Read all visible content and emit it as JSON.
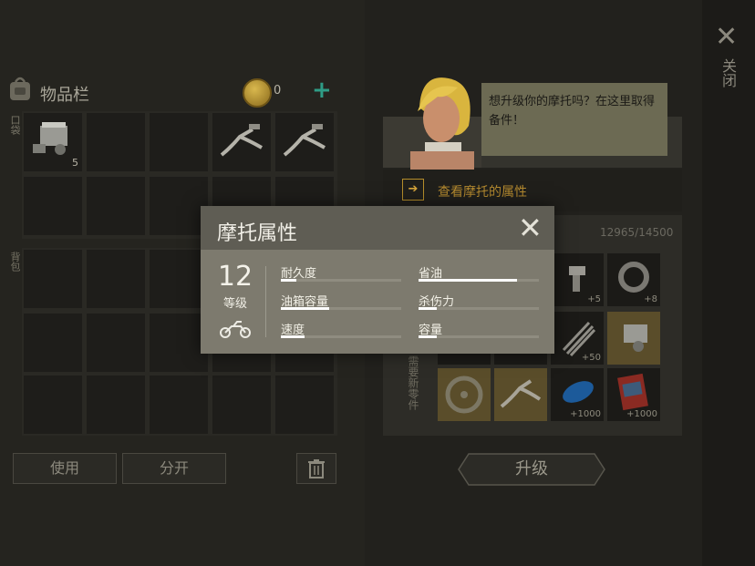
{
  "inventory": {
    "title": "物品栏",
    "coins": "0",
    "pocket_label": "口袋",
    "backpack_label": "背包",
    "slot1_count": "5",
    "use_label": "使用",
    "split_label": "分开"
  },
  "upgrade": {
    "bubble_text": "想升级你的摩托吗？在这里取得备件！",
    "view_props_label": "查看摩托的属性",
    "progress": "12965/14500",
    "req_label": "需要新零件",
    "counts": {
      "r1b": "+5",
      "r1c": "+8",
      "r2c": "+50",
      "r3c": "+1000",
      "r3d": "+1000"
    },
    "upgrade_label": "升级",
    "close_label": "关闭"
  },
  "dialog": {
    "title": "摩托属性",
    "level": "12",
    "level_label": "等级",
    "stats": {
      "durability": {
        "label": "耐久度",
        "value": 0.13
      },
      "fuel_capacity": {
        "label": "油箱容量",
        "value": 0.4
      },
      "speed": {
        "label": "速度",
        "value": 0.2
      },
      "fuel_saving": {
        "label": "省油",
        "value": 0.82
      },
      "damage": {
        "label": "杀伤力",
        "value": 0.15
      },
      "capacity": {
        "label": "容量",
        "value": 0.15
      }
    }
  },
  "colors": {
    "accent_gold": "#b3892f",
    "coin_plus": "#2f9c86"
  }
}
